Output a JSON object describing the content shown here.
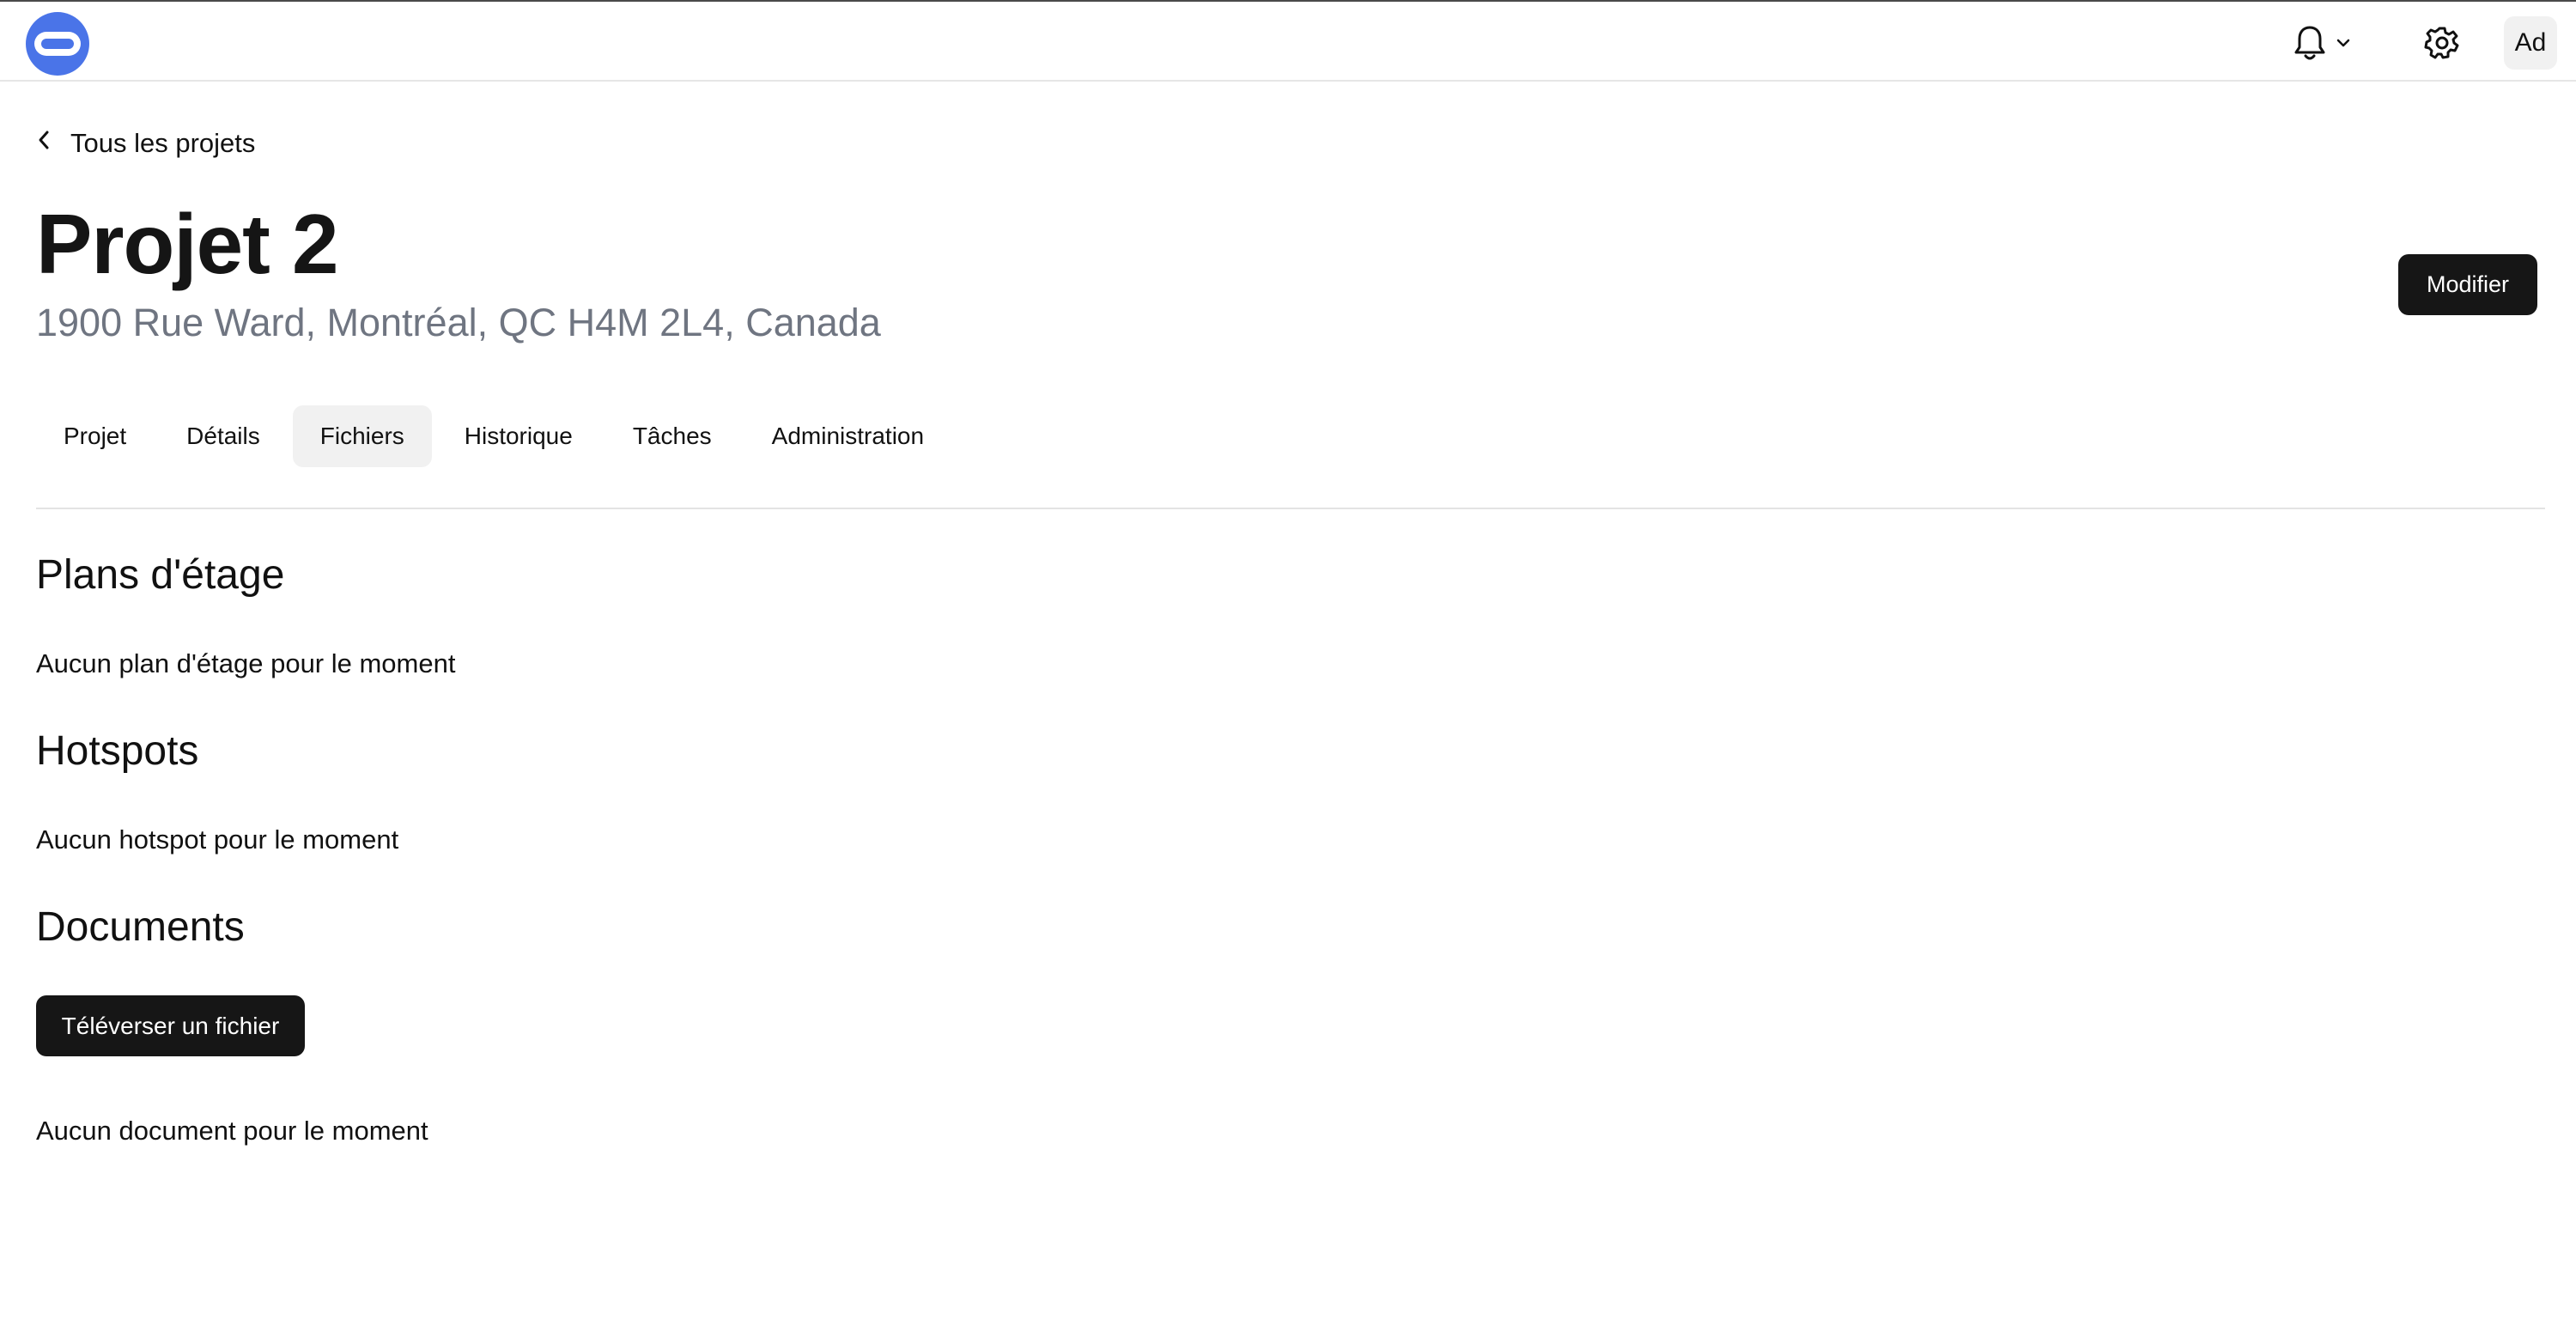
{
  "header": {
    "logo_icon": "app-logo-icon",
    "notifications_icon": "bell-icon",
    "notifications_dropdown_icon": "chevron-down-icon",
    "settings_icon": "gear-icon",
    "avatar_initials": "Ad",
    "brand_color": "#4a74e8"
  },
  "breadcrumb": {
    "back_icon": "chevron-left-icon",
    "label": "Tous les projets"
  },
  "project": {
    "title": "Projet 2",
    "address": "1900 Rue Ward, Montréal, QC H4M 2L4, Canada",
    "edit_label": "Modifier"
  },
  "tabs": [
    {
      "label": "Projet",
      "active": false
    },
    {
      "label": "Détails",
      "active": false
    },
    {
      "label": "Fichiers",
      "active": true
    },
    {
      "label": "Historique",
      "active": false
    },
    {
      "label": "Tâches",
      "active": false
    },
    {
      "label": "Administration",
      "active": false
    }
  ],
  "sections": {
    "floor_plans": {
      "title": "Plans d'étage",
      "empty": "Aucun plan d'étage pour le moment"
    },
    "hotspots": {
      "title": "Hotspots",
      "empty": "Aucun hotspot pour le moment"
    },
    "documents": {
      "title": "Documents",
      "upload_label": "Téléverser un fichier",
      "empty": "Aucun document pour le moment"
    }
  }
}
